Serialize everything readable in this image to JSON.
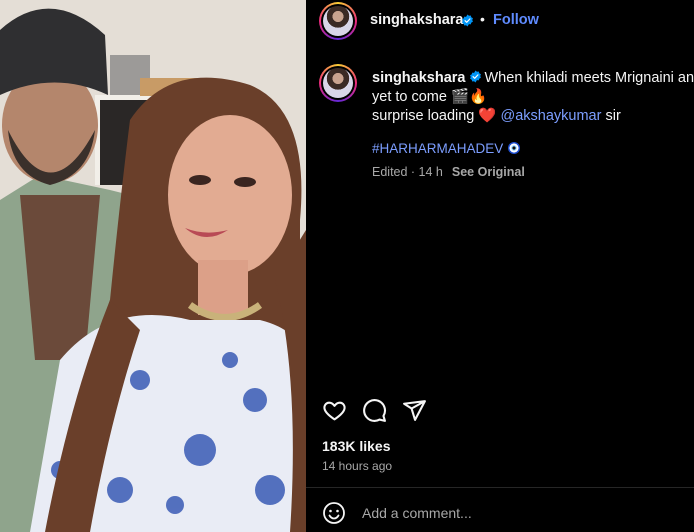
{
  "post_photo": {
    "alt": ""
  },
  "header": {
    "username": "singhakshara",
    "separator": "•",
    "follow_label": "Follow"
  },
  "caption": {
    "username": "singhakshara",
    "line1": "When khiladi meets Mrignaini and",
    "line2": "yet to come 🎬🔥",
    "line3_prefix": "surprise loading ❤️",
    "mention": "@akshaykumar",
    "line3_suffix": "sir",
    "hashtag": "#HARHARMAHADEV"
  },
  "meta": {
    "edited": "Edited · 14 h",
    "see_original": "See Original"
  },
  "actions": {
    "like_icon": "heart-icon",
    "comment_icon": "comment-icon",
    "share_icon": "send-icon"
  },
  "stats": {
    "likes": "183K likes",
    "time_ago": "14 hours ago"
  },
  "comment_box": {
    "emoji_icon": "smiley-icon",
    "placeholder": "Add a comment..."
  },
  "colors": {
    "background": "#000000",
    "link_blue": "#5f8bff",
    "muted": "#a8a8a8",
    "verified": "#0095f6"
  }
}
